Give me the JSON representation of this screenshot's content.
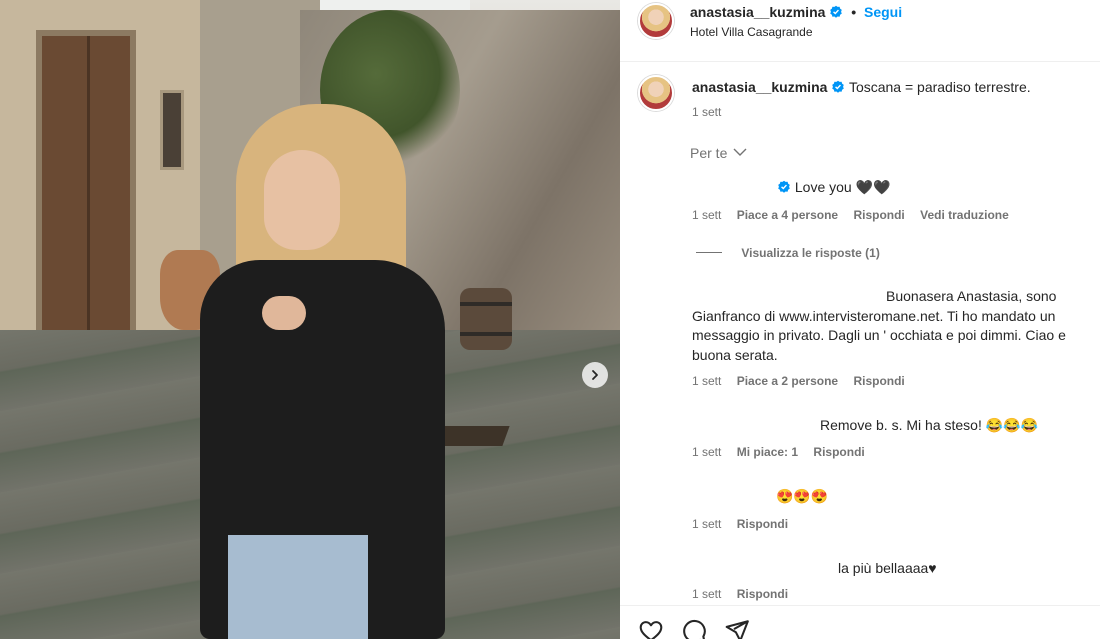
{
  "post": {
    "username": "anastasia__kuzmina",
    "follow_label": "Segui",
    "separator": "•",
    "location": "Hotel Villa Casagrande",
    "caption": "Toscana = paradiso terrestre.",
    "caption_time": "1 sett"
  },
  "comments_filter": {
    "label": "Per te"
  },
  "comments": [
    {
      "text": "Love you 🖤🖤",
      "time": "1 sett",
      "likes": "Piace a 4 persone",
      "reply": "Rispondi",
      "translate": "Vedi traduzione",
      "view_replies": "Visualizza le risposte (1)"
    },
    {
      "text_line1": "Buonasera Anastasia, sono",
      "text_line2": "Gianfranco di www.intervisteromane.net. Ti ho mandato un",
      "text_line3": "messaggio in privato. Dagli un ' occhiata e poi dimmi. Ciao e",
      "text_line4": "buona serata.",
      "time": "1 sett",
      "likes": "Piace a 2 persone",
      "reply": "Rispondi"
    },
    {
      "text": "Remove b. s. Mi ha steso! 😂😂😂",
      "time": "1 sett",
      "likes": "Mi piace: 1",
      "reply": "Rispondi"
    },
    {
      "text": "😍😍😍",
      "time": "1 sett",
      "reply": "Rispondi"
    },
    {
      "text": "la più bellaaaa♥",
      "time": "1 sett",
      "reply": "Rispondi"
    }
  ],
  "icons": {
    "verified_color": "#0095f6",
    "like": "heart-icon",
    "comment": "comment-icon",
    "share": "share-icon",
    "next": "chevron-right-icon"
  }
}
